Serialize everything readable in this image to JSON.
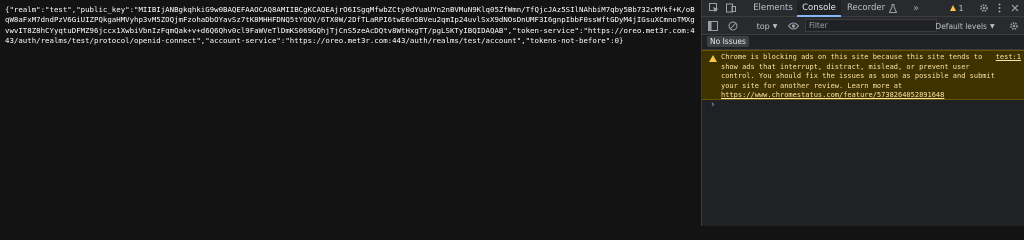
{
  "page": {
    "json_text": "{\"realm\":\"test\",\"public_key\":\"MIIBIjANBgkqhkiG9w0BAQEFAAOCAQ8AMIIBCgKCAQEAjrO6ISgqMfwbZCty0dYuaUYn2nBVMuN9Klq05ZfWmn/TfQjcJAz5SIlNAhbiM7qby5Bb732cMYkf+K/oBqW8aFxM7dndPzV6GiUIZPQkgaHMVyhp3vM5ZOQjmFzohaDbOYavSz7tK8MHHFDNQ5tYOQV/6TX0W/2DfTLaRPI6twE6n5BVeu2qmIp24uvlSxX9dNOsDnUMF3I6gnpIbbF0ssWftGDyM4jIGsuXCmnoTMXgvwvIT8Z8hCYyqtuDFMZ96jccx1XwbiVbnIzFqmQak+v+d6Q6Qhv0cl9FaWVeTlDmKS069GQhjTjCnS5zeAcDQtv8WtHxgTT/pgLSKTyIBQIDAQAB\",\"token-service\":\"https://oreo.met3r.com:443/auth/realms/test/protocol/openid-connect\",\"account-service\":\"https://oreo.met3r.com:443/auth/realms/test/account\",\"tokens-not-before\":0}"
  },
  "devtools": {
    "tabs": [
      "Elements",
      "Console",
      "Recorder"
    ],
    "active_tab": "Console",
    "recorder_icon": "flask-icon",
    "more_tabs_glyph": "»",
    "warning_count": "1",
    "context_select": "top",
    "filter_placeholder": "Filter",
    "levels_select": "Default levels",
    "no_issues": "No Issues",
    "warning": {
      "text": "Chrome is blocking ads on this site because this site tends to show ads that interrupt, distract, mislead, or prevent user control. You should fix the issues as soon as possible and submit your site for another review. Learn more at ",
      "link": "https://www.chromestatus.com/feature/5738264052891648",
      "source": "test:1"
    },
    "prompt": "›",
    "colors": {
      "panel_bg": "#202124",
      "page_bg": "#131313",
      "accent": "#8ab4f8",
      "warning_bg": "#3d3200",
      "warning_text": "#fce3a6",
      "warning_icon": "#f9c748"
    }
  }
}
